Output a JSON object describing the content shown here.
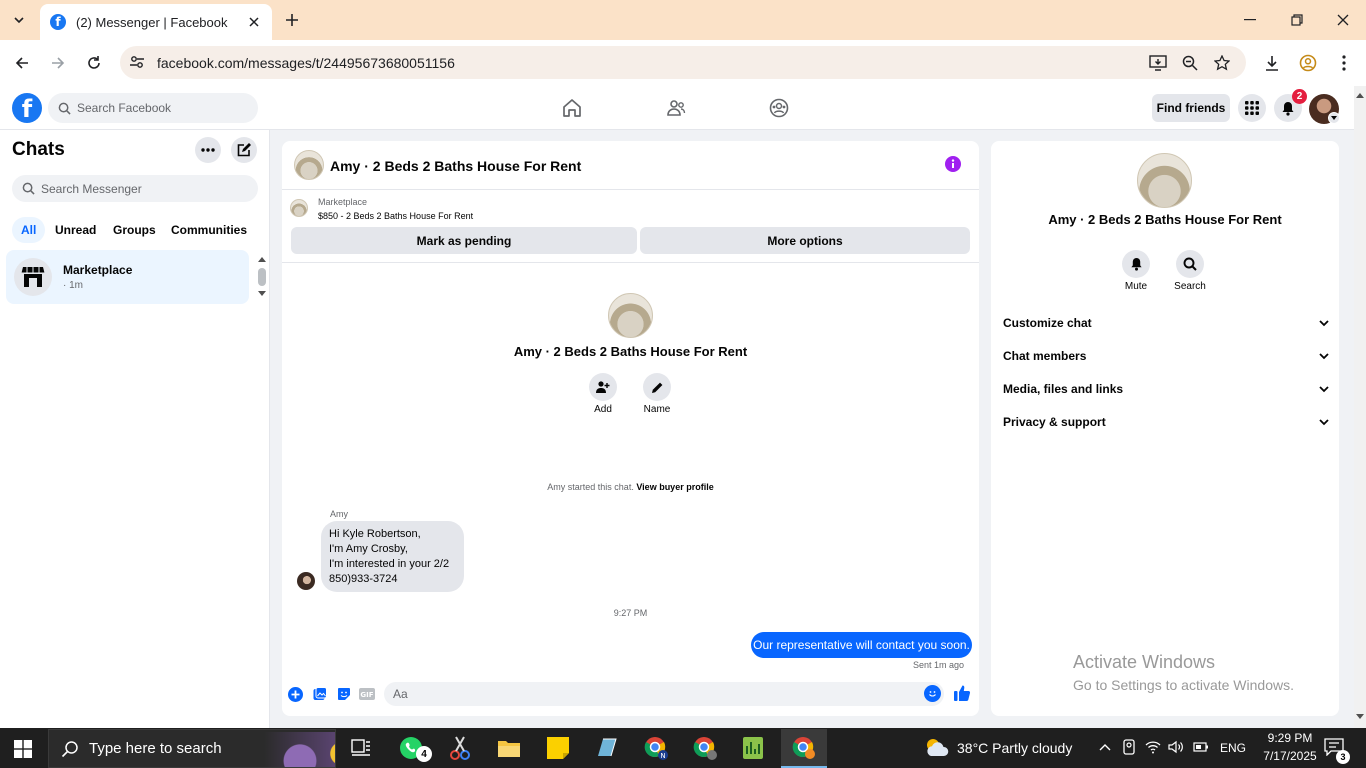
{
  "browser": {
    "tab_title": "(2) Messenger | Facebook",
    "favicon_letter": "f",
    "url": "facebook.com/messages/t/24495673680051156"
  },
  "header": {
    "logo_letter": "f",
    "search_placeholder": "Search Facebook",
    "find_friends_label": "Find friends",
    "notification_count": "2"
  },
  "sidebar": {
    "title": "Chats",
    "search_placeholder": "Search Messenger",
    "filters": [
      "All",
      "Unread",
      "Groups",
      "Communities"
    ],
    "active_filter": "All",
    "conversations": [
      {
        "name": "Marketplace",
        "time": "· 1m"
      }
    ]
  },
  "conversation": {
    "title": "Amy · 2 Beds 2 Baths House For Rent",
    "marketplace_label": "Marketplace",
    "listing": "$850 - 2 Beds 2 Baths House For Rent",
    "mark_pending_label": "Mark as pending",
    "more_options_label": "More options",
    "add_label": "Add",
    "name_label": "Name",
    "started_text": "Amy started this chat.",
    "view_profile_label": "View buyer profile",
    "sender_name": "Amy",
    "incoming_lines": [
      "Hi Kyle Robertson,",
      "I'm Amy Crosby,",
      "I'm interested in your 2/2",
      "850)933-3724"
    ],
    "timestamp": "9:27 PM",
    "outgoing_message": "Our representative will contact you soon.",
    "sent_status": "Sent 1m ago",
    "composer_placeholder": "Aa"
  },
  "info_panel": {
    "title": "Amy · 2 Beds 2 Baths House For Rent",
    "mute_label": "Mute",
    "search_label": "Search",
    "sections": [
      "Customize chat",
      "Chat members",
      "Media, files and links",
      "Privacy & support"
    ]
  },
  "watermark": {
    "line1": "Activate Windows",
    "line2": "Go to Settings to activate Windows."
  },
  "taskbar": {
    "search_placeholder": "Type here to search",
    "whatsapp_badge": "4",
    "weather": "38°C  Partly cloudy",
    "language": "ENG",
    "time": "9:29 PM",
    "date": "7/17/2025",
    "notification_count": "3"
  },
  "colors": {
    "facebook_blue": "#1877f2",
    "messenger_blue": "#0866ff",
    "info_purple": "#a020f0",
    "tabstrip": "#fbe2c8"
  }
}
